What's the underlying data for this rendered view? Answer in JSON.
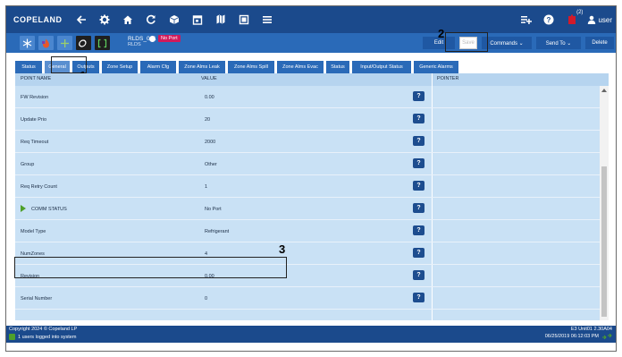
{
  "topbar": {
    "logo": "COPELAND",
    "icons": [
      "back-arrow-icon",
      "gear-icon",
      "home-icon",
      "refresh-icon",
      "box-icon",
      "calendar-icon",
      "map-icon",
      "list-icon"
    ],
    "right_icons": [
      "add-list-icon",
      "help-icon",
      "alarm-icon"
    ],
    "alarm_count": "(2)",
    "user": "user"
  },
  "secbar": {
    "device_name": "RLDS_001",
    "device_sub": "RLDS",
    "status": "No Port",
    "buttons": {
      "edit": "Edit",
      "save": "Save",
      "commands": "Commands ⌄",
      "send_to": "Send To ⌄",
      "delete": "Delete"
    }
  },
  "tabs": [
    "Status",
    "General",
    "Outputs",
    "Zone Setup",
    "Alarm Cfg",
    "Zone Alms Leak",
    "Zone Alms Spill",
    "Zone Alms Evac",
    "Status",
    "Input/Output Status",
    "Generic Alarms"
  ],
  "table": {
    "headers": {
      "point_name": "POINT NAME",
      "value": "VALUE",
      "pointer": "POINTER"
    },
    "rows": [
      {
        "name": "FW Revision",
        "value": "0.00"
      },
      {
        "name": "Update Prio",
        "value": "20"
      },
      {
        "name": "Req Timeout",
        "value": "2000"
      },
      {
        "name": "Group",
        "value": "Other"
      },
      {
        "name": "Req Retry Count",
        "value": "1"
      },
      {
        "name": "COMM STATUS",
        "value": "No Port"
      },
      {
        "name": "Model Type",
        "value": "Refrigerant"
      },
      {
        "name": "NumZones",
        "value": "4"
      },
      {
        "name": "Revision",
        "value": "0.00"
      },
      {
        "name": "Serial Number",
        "value": "0"
      }
    ],
    "help_label": "?"
  },
  "callouts": {
    "c1": "1",
    "c2": "2",
    "c3": "3"
  },
  "footer": {
    "copyright": "Copyright 2024 © Copeland LP",
    "users": "1 users logged into system",
    "unit": "E3 Unit01 2.30A04",
    "datetime": "06/25/2019 06:12:03 PM"
  },
  "colors": {
    "topbar": "#1b4a8c",
    "secbar": "#2a6ab8",
    "table_bg": "#c9e1f5",
    "noport": "#d11a5a",
    "help_btn": "#1d4d8f"
  }
}
